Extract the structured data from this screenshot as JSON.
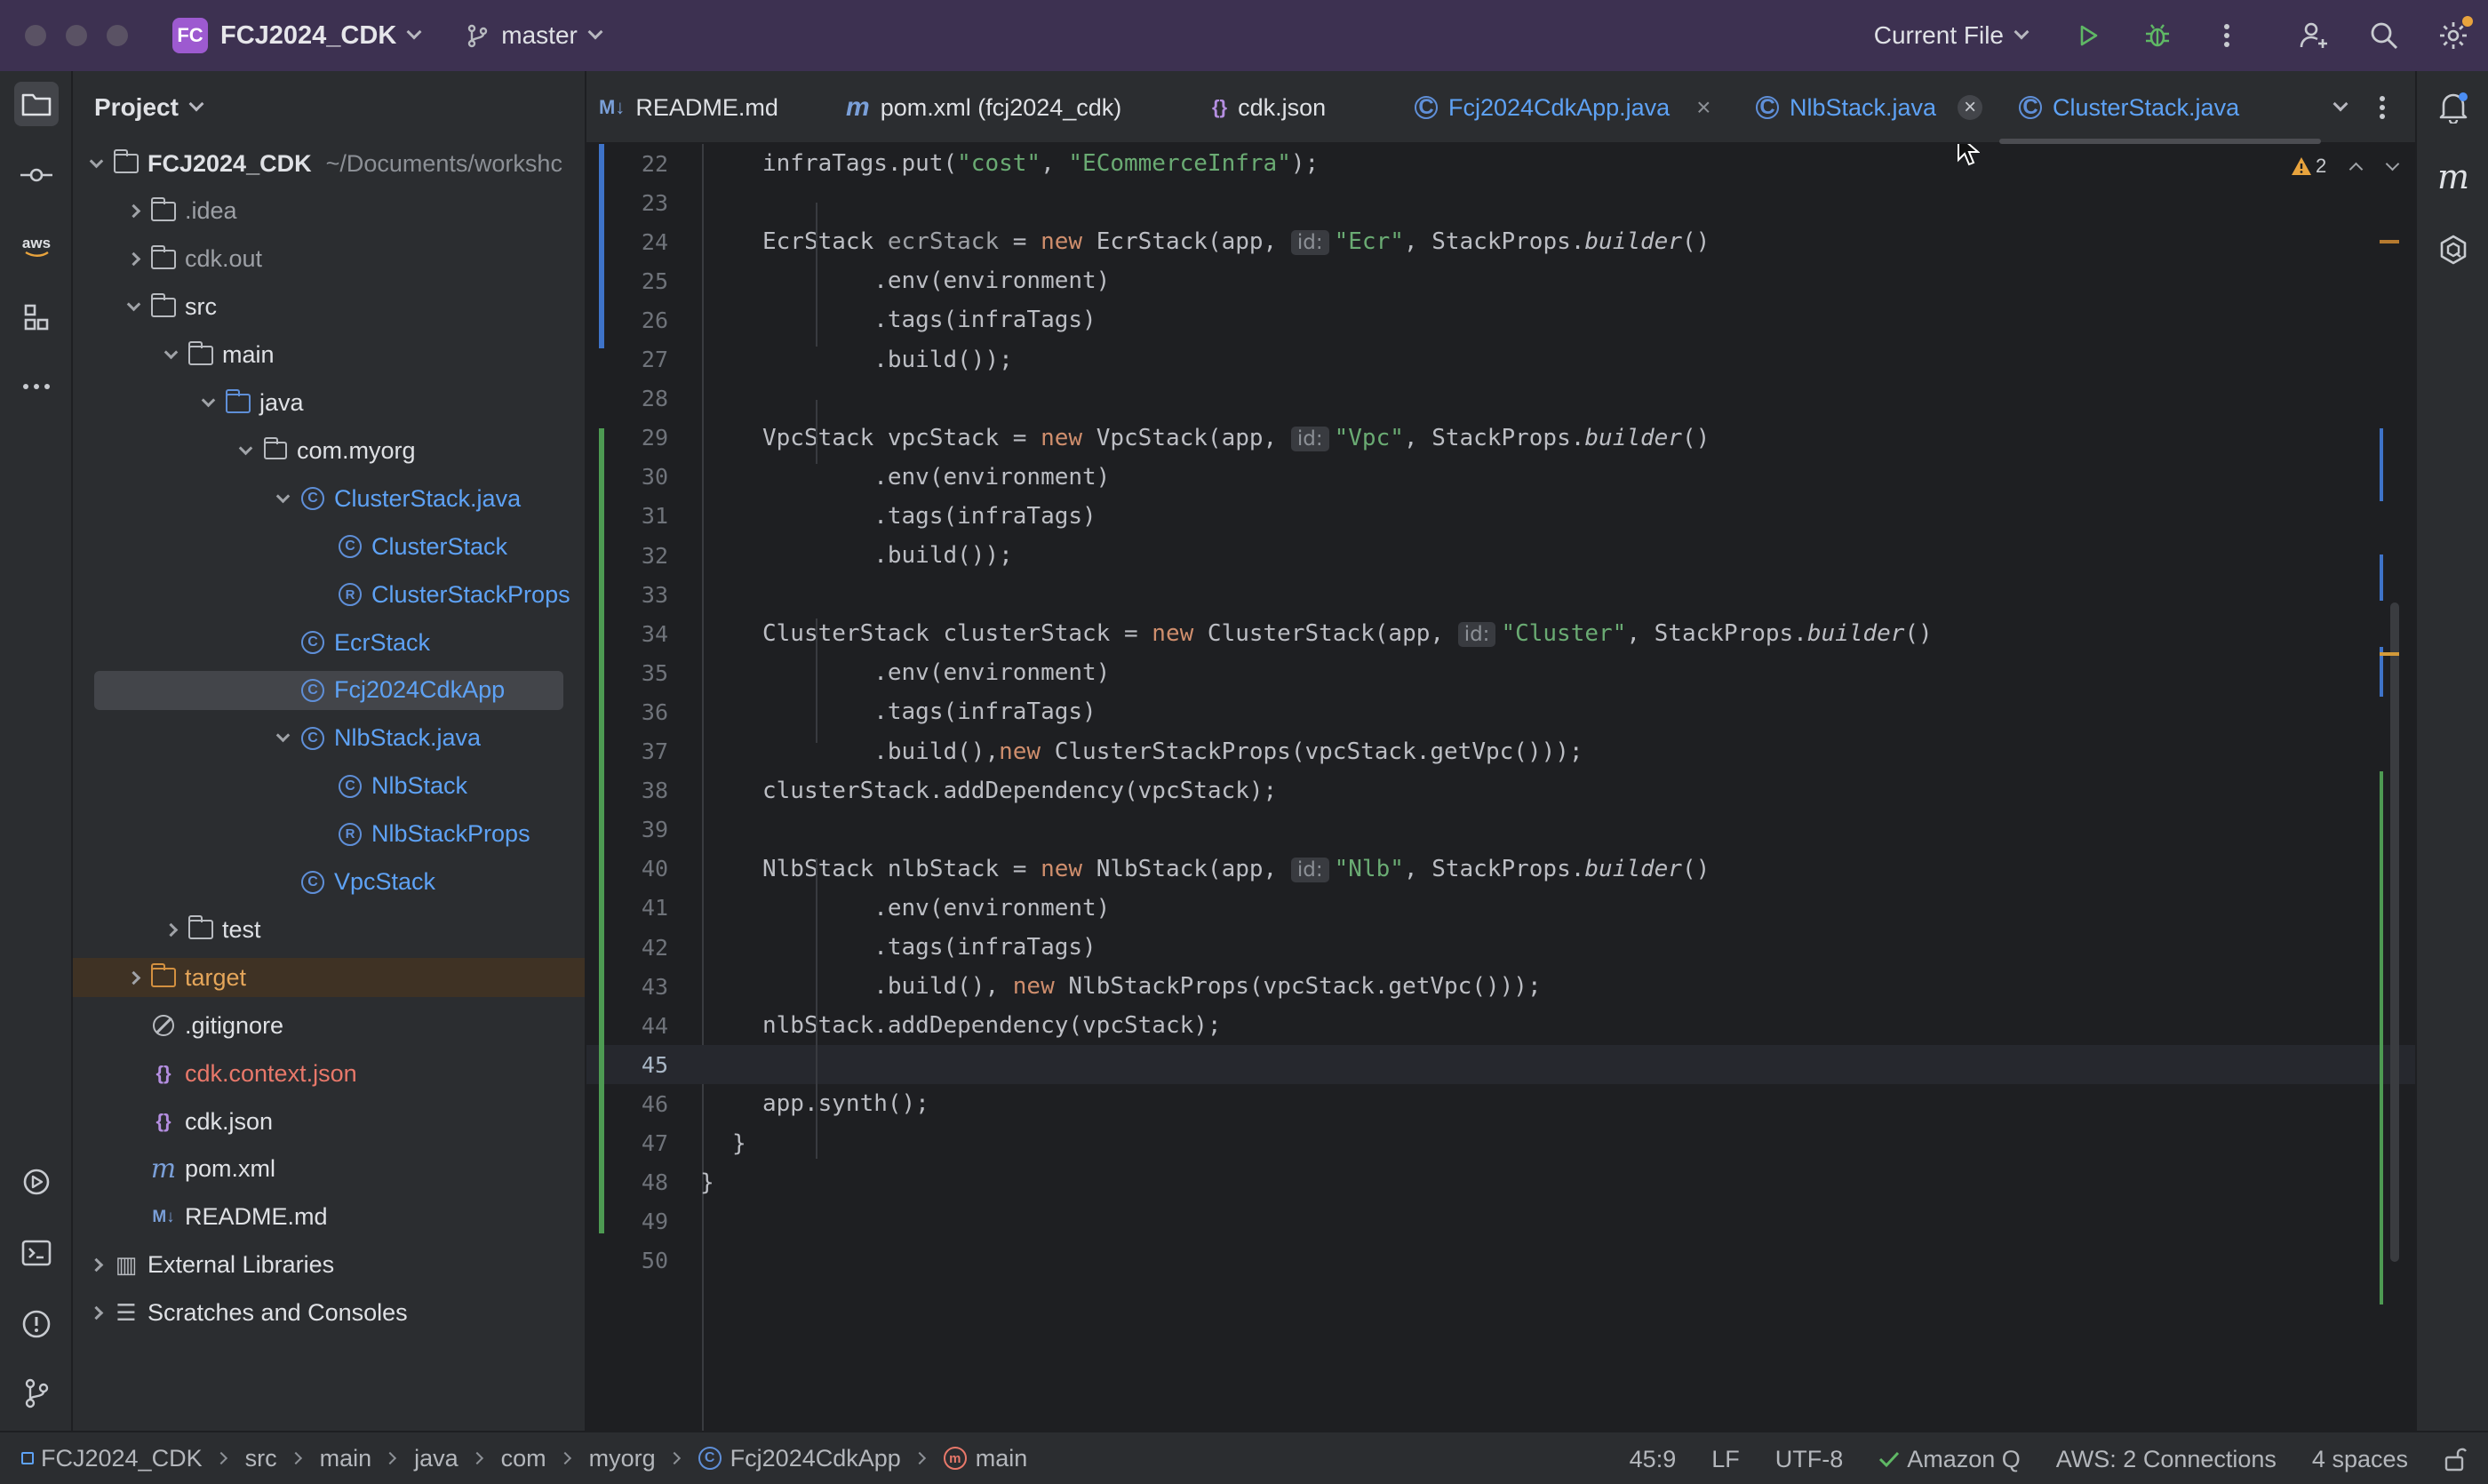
{
  "titlebar": {
    "project_badge": "FC",
    "project_name": "FCJ2024_CDK",
    "branch": "master",
    "run_config": "Current File"
  },
  "project_panel": {
    "title": "Project",
    "tree": [
      {
        "label": "FCJ2024_CDK",
        "suffix": "~/Documents/workshc",
        "indent": 0,
        "arrow": "down",
        "icon": "module"
      },
      {
        "label": ".idea",
        "indent": 1,
        "arrow": "right",
        "icon": "folder"
      },
      {
        "label": "cdk.out",
        "indent": 1,
        "arrow": "right",
        "icon": "folder"
      },
      {
        "label": "src",
        "indent": 1,
        "arrow": "down",
        "icon": "folder"
      },
      {
        "label": "main",
        "indent": 2,
        "arrow": "down",
        "icon": "folder"
      },
      {
        "label": "java",
        "indent": 3,
        "arrow": "down",
        "icon": "folder-blue"
      },
      {
        "label": "com.myorg",
        "indent": 4,
        "arrow": "down",
        "icon": "package"
      },
      {
        "label": "ClusterStack.java",
        "indent": 5,
        "arrow": "down",
        "icon": "class"
      },
      {
        "label": "ClusterStack",
        "indent": 6,
        "arrow": "none",
        "icon": "class"
      },
      {
        "label": "ClusterStackProps",
        "indent": 6,
        "arrow": "none",
        "icon": "record"
      },
      {
        "label": "EcrStack",
        "indent": 5,
        "arrow": "none",
        "icon": "class"
      },
      {
        "label": "Fcj2024CdkApp",
        "indent": 5,
        "arrow": "none",
        "icon": "class"
      },
      {
        "label": "NlbStack.java",
        "indent": 5,
        "arrow": "down",
        "icon": "class"
      },
      {
        "label": "NlbStack",
        "indent": 6,
        "arrow": "none",
        "icon": "class"
      },
      {
        "label": "NlbStackProps",
        "indent": 6,
        "arrow": "none",
        "icon": "record"
      },
      {
        "label": "VpcStack",
        "indent": 5,
        "arrow": "none",
        "icon": "class"
      },
      {
        "label": "test",
        "indent": 2,
        "arrow": "right",
        "icon": "folder"
      },
      {
        "label": "target",
        "indent": 1,
        "arrow": "right",
        "icon": "folder-orange"
      },
      {
        "label": ".gitignore",
        "indent": 1,
        "arrow": "none",
        "icon": "ignore"
      },
      {
        "label": "cdk.context.json",
        "indent": 1,
        "arrow": "none",
        "icon": "json"
      },
      {
        "label": "cdk.json",
        "indent": 1,
        "arrow": "none",
        "icon": "json"
      },
      {
        "label": "pom.xml",
        "indent": 1,
        "arrow": "none",
        "icon": "maven"
      },
      {
        "label": "README.md",
        "indent": 1,
        "arrow": "none",
        "icon": "markdown"
      },
      {
        "label": "External Libraries",
        "indent": 0,
        "arrow": "right",
        "icon": "library"
      },
      {
        "label": "Scratches and Consoles",
        "indent": 0,
        "arrow": "right",
        "icon": "scratches"
      }
    ]
  },
  "tabs": [
    {
      "label": "README.md",
      "icon": "M↓"
    },
    {
      "label": "pom.xml (fcj2024_cdk)",
      "icon": "m"
    },
    {
      "label": "cdk.json",
      "icon": "{}"
    },
    {
      "label": "Fcj2024CdkApp.java",
      "icon": "C"
    },
    {
      "label": "NlbStack.java",
      "icon": "C"
    },
    {
      "label": "ClusterStack.java",
      "icon": "C"
    }
  ],
  "editor": {
    "warning_count": "2",
    "current_line": 45,
    "lines": [
      {
        "n": "22",
        "tokens": [
          [
            "",
            "infraTags.put("
          ],
          [
            "str",
            "\"cost\""
          ],
          [
            "",
            ", "
          ],
          [
            "str",
            "\"ECommerceInfra\""
          ],
          [
            "",
            ");"
          ]
        ]
      },
      {
        "n": "23",
        "tokens": []
      },
      {
        "n": "24",
        "tokens": [
          [
            "",
            "EcrStack "
          ],
          [
            "var",
            "ecrStack"
          ],
          [
            "",
            " = "
          ],
          [
            "kw",
            "new"
          ],
          [
            "",
            " EcrStack(app, "
          ],
          [
            "hint",
            "id:"
          ],
          [
            "str",
            "\"Ecr\""
          ],
          [
            "",
            ", StackProps."
          ],
          [
            "it",
            "builder"
          ],
          [
            "",
            "()"
          ]
        ]
      },
      {
        "n": "25",
        "tokens": [
          [
            "",
            "        .env(environment)"
          ]
        ]
      },
      {
        "n": "26",
        "tokens": [
          [
            "",
            "        .tags(infraTags)"
          ]
        ]
      },
      {
        "n": "27",
        "tokens": [
          [
            "",
            "        .build());"
          ]
        ]
      },
      {
        "n": "28",
        "tokens": []
      },
      {
        "n": "29",
        "tokens": [
          [
            "",
            "VpcStack vpcStack = "
          ],
          [
            "kw",
            "new"
          ],
          [
            "",
            " VpcStack(app, "
          ],
          [
            "hint",
            "id:"
          ],
          [
            "str",
            "\"Vpc\""
          ],
          [
            "",
            ", StackProps."
          ],
          [
            "it",
            "builder"
          ],
          [
            "",
            "()"
          ]
        ]
      },
      {
        "n": "30",
        "tokens": [
          [
            "",
            "        .env(environment)"
          ]
        ]
      },
      {
        "n": "31",
        "tokens": [
          [
            "",
            "        .tags(infraTags)"
          ]
        ]
      },
      {
        "n": "32",
        "tokens": [
          [
            "",
            "        .build());"
          ]
        ]
      },
      {
        "n": "33",
        "tokens": []
      },
      {
        "n": "34",
        "tokens": [
          [
            "",
            "ClusterStack clusterStack = "
          ],
          [
            "kw",
            "new"
          ],
          [
            "",
            " ClusterStack(app, "
          ],
          [
            "hint",
            "id:"
          ],
          [
            "str",
            "\"Cluster\""
          ],
          [
            "",
            ", StackProps."
          ],
          [
            "it",
            "builder"
          ],
          [
            "",
            "()"
          ]
        ]
      },
      {
        "n": "35",
        "tokens": [
          [
            "",
            "        .env(environment)"
          ]
        ]
      },
      {
        "n": "36",
        "tokens": [
          [
            "",
            "        .tags(infraTags)"
          ]
        ]
      },
      {
        "n": "37",
        "tokens": [
          [
            "",
            "        .build(),"
          ],
          [
            "kw",
            "new"
          ],
          [
            "",
            " ClusterStackProps(vpcStack.getVpc()));"
          ]
        ]
      },
      {
        "n": "38",
        "tokens": [
          [
            "",
            "clusterStack.addDependency(vpcStack);"
          ]
        ]
      },
      {
        "n": "39",
        "tokens": []
      },
      {
        "n": "40",
        "tokens": [
          [
            "",
            "NlbStack nlbStack = "
          ],
          [
            "kw",
            "new"
          ],
          [
            "",
            " NlbStack(app, "
          ],
          [
            "hint",
            "id:"
          ],
          [
            "str",
            "\"Nlb\""
          ],
          [
            "",
            ", StackProps."
          ],
          [
            "it",
            "builder"
          ],
          [
            "",
            "()"
          ]
        ]
      },
      {
        "n": "41",
        "tokens": [
          [
            "",
            "        .env(environment)"
          ]
        ]
      },
      {
        "n": "42",
        "tokens": [
          [
            "",
            "        .tags(infraTags)"
          ]
        ]
      },
      {
        "n": "43",
        "tokens": [
          [
            "",
            "        .build(), "
          ],
          [
            "kw",
            "new"
          ],
          [
            "",
            " NlbStackProps(vpcStack.getVpc()));"
          ]
        ]
      },
      {
        "n": "44",
        "tokens": [
          [
            "",
            "nlbStack.addDependency(vpcStack);"
          ]
        ]
      },
      {
        "n": "45",
        "tokens": []
      },
      {
        "n": "46",
        "tokens": [
          [
            "",
            "app.synth();"
          ]
        ]
      },
      {
        "n": "47",
        "tokens": [
          [
            "",
            "}"
          ]
        ]
      },
      {
        "n": "48",
        "tokens": [
          [
            "",
            "}"
          ]
        ]
      },
      {
        "n": "49",
        "tokens": []
      },
      {
        "n": "50",
        "tokens": []
      }
    ]
  },
  "statusbar": {
    "breadcrumbs": [
      "FCJ2024_CDK",
      "src",
      "main",
      "java",
      "com",
      "myorg",
      "Fcj2024CdkApp",
      "main"
    ],
    "position": "45:9",
    "line_sep": "LF",
    "encoding": "UTF-8",
    "amazon_q": "Amazon Q",
    "aws": "AWS: 2 Connections",
    "indent": "4 spaces"
  }
}
